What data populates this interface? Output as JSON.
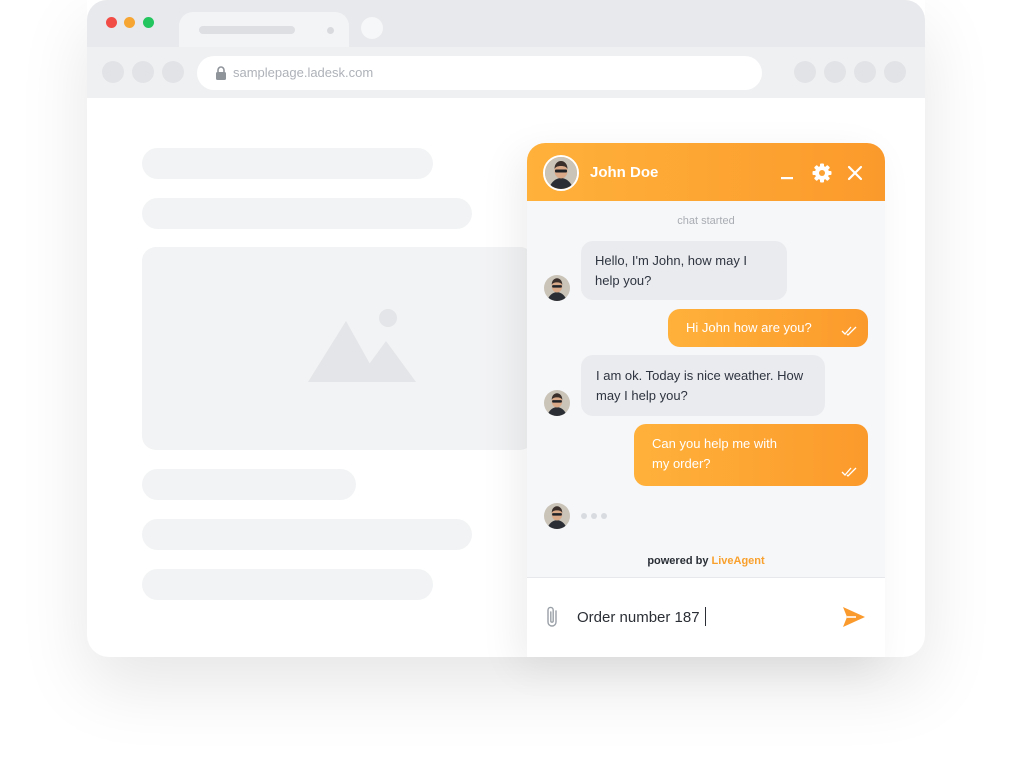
{
  "browser": {
    "url": "samplepage.ladesk.com",
    "traffic_lights": [
      "#f24c47",
      "#f7a532",
      "#22c55e"
    ]
  },
  "chat": {
    "agent_name": "John Doe",
    "status_text": "chat started",
    "messages": [
      {
        "from": "agent",
        "lines": [
          "Hello, I'm John, how may I",
          "help you?"
        ]
      },
      {
        "from": "visitor",
        "lines": [
          "Hi John how are you?"
        ]
      },
      {
        "from": "agent",
        "lines": [
          "I am ok. Today is nice weather. How",
          "may I help you?"
        ]
      },
      {
        "from": "visitor",
        "lines": [
          "Can you help me with",
          "my order?"
        ]
      }
    ],
    "powered_by": "powered by",
    "brand": "LiveAgent",
    "input_value": "Order number 187",
    "icons": {
      "minimize": "minimize-icon",
      "settings": "gear-icon",
      "close": "close-icon",
      "attach": "paperclip-icon",
      "send": "send-icon",
      "read": "double-check-icon"
    },
    "colors": {
      "accent": "#fb9a2c",
      "accent_light": "#ffb13b",
      "bubble_in": "#eaebee"
    }
  }
}
